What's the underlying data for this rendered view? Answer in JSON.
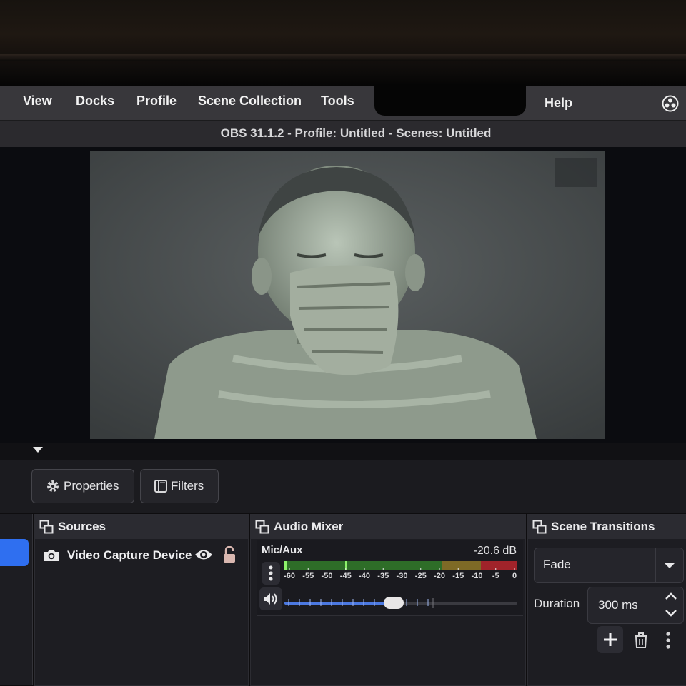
{
  "menubar": {
    "items": [
      "View",
      "Docks",
      "Profile",
      "Scene Collection",
      "Tools",
      "Help"
    ]
  },
  "window": {
    "title": "OBS 31.1.2 - Profile: Untitled - Scenes: Untitled"
  },
  "toolbar": {
    "properties_label": "Properties",
    "filters_label": "Filters"
  },
  "sources": {
    "title": "Sources",
    "items": [
      {
        "label": "Video Capture Device",
        "icon": "camera-icon",
        "visible": true,
        "locked": false
      }
    ]
  },
  "audio_mixer": {
    "title": "Audio Mixer",
    "channel": {
      "name": "Mic/Aux",
      "level": "-20.6 dB",
      "meter_ticks": [
        "-60",
        "-55",
        "-50",
        "-45",
        "-40",
        "-35",
        "-30",
        "-25",
        "-20",
        "-15",
        "-10",
        "-5",
        "0"
      ],
      "volume_fraction": 0.47
    }
  },
  "scene_transitions": {
    "title": "Scene Transitions",
    "transition": "Fade",
    "duration_label": "Duration",
    "duration_value": "300 ms"
  },
  "colors": {
    "accent": "#2f6ff0",
    "meter_green": "#3f8f33",
    "meter_yellow": "#a0852c",
    "meter_red": "#b3262c",
    "slider_blue": "#4b78e0"
  }
}
